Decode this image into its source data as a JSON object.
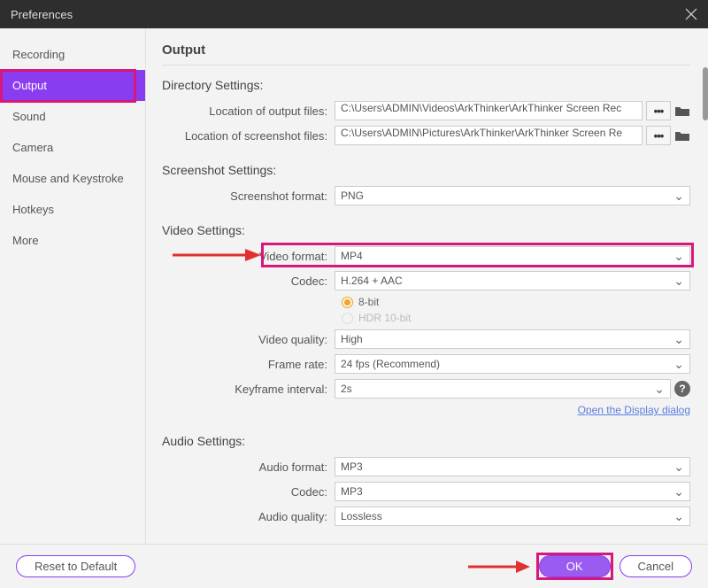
{
  "window": {
    "title": "Preferences"
  },
  "sidebar": {
    "items": [
      {
        "label": "Recording"
      },
      {
        "label": "Output"
      },
      {
        "label": "Sound"
      },
      {
        "label": "Camera"
      },
      {
        "label": "Mouse and Keystroke"
      },
      {
        "label": "Hotkeys"
      },
      {
        "label": "More"
      }
    ],
    "activeIndex": 1
  },
  "page": {
    "title": "Output",
    "directory": {
      "heading": "Directory Settings:",
      "outputLabel": "Location of output files:",
      "outputPath": "C:\\Users\\ADMIN\\Videos\\ArkThinker\\ArkThinker Screen Rec",
      "screenshotLabel": "Location of screenshot files:",
      "screenshotPath": "C:\\Users\\ADMIN\\Pictures\\ArkThinker\\ArkThinker Screen Re"
    },
    "screenshot": {
      "heading": "Screenshot Settings:",
      "formatLabel": "Screenshot format:",
      "formatValue": "PNG"
    },
    "video": {
      "heading": "Video Settings:",
      "formatLabel": "Video format:",
      "formatValue": "MP4",
      "codecLabel": "Codec:",
      "codecValue": "H.264 + AAC",
      "bit8": "8-bit",
      "hdr10": "HDR 10-bit",
      "qualityLabel": "Video quality:",
      "qualityValue": "High",
      "framerateLabel": "Frame rate:",
      "framerateValue": "24 fps (Recommend)",
      "keyframeLabel": "Keyframe interval:",
      "keyframeValue": "2s",
      "link": "Open the Display dialog"
    },
    "audio": {
      "heading": "Audio Settings:",
      "formatLabel": "Audio format:",
      "formatValue": "MP3",
      "codecLabel": "Codec:",
      "codecValue": "MP3",
      "qualityLabel": "Audio quality:",
      "qualityValue": "Lossless"
    }
  },
  "footer": {
    "reset": "Reset to Default",
    "ok": "OK",
    "cancel": "Cancel"
  },
  "colors": {
    "accent": "#8a3df0",
    "highlight": "#d6177c",
    "arrow": "#e03030"
  }
}
